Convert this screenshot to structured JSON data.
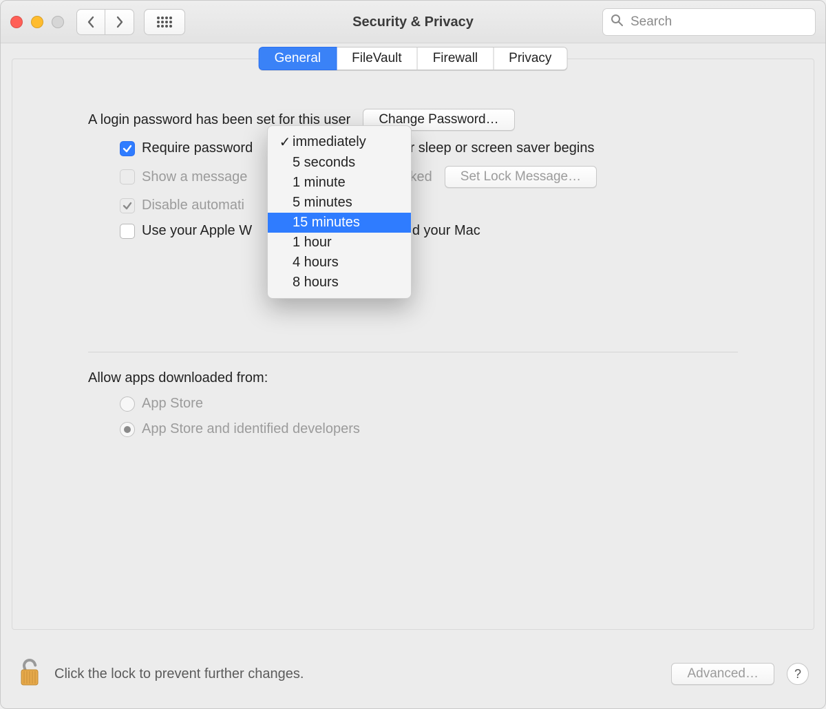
{
  "window": {
    "title": "Security & Privacy"
  },
  "search": {
    "placeholder": "Search"
  },
  "tabs": {
    "general": "General",
    "filevault": "FileVault",
    "firewall": "Firewall",
    "privacy": "Privacy"
  },
  "content": {
    "login_password_set": "A login password has been set for this user",
    "change_password_btn": "Change Password…",
    "require_password_label_pre": "Require password",
    "require_password_label_post": "after sleep or screen saver begins",
    "show_message_label": "Show a message",
    "show_message_label_suffix": "s locked",
    "set_lock_message_btn": "Set Lock Message…",
    "disable_automatic_label": "Disable automati",
    "use_apple_watch_label_pre": "Use your Apple W",
    "use_apple_watch_label_post": "s and your Mac",
    "allow_apps_heading": "Allow apps downloaded from:",
    "radio_app_store": "App Store",
    "radio_identified": "App Store and identified developers"
  },
  "dropdown": {
    "options": [
      "immediately",
      "5 seconds",
      "1 minute",
      "5 minutes",
      "15 minutes",
      "1 hour",
      "4 hours",
      "8 hours"
    ],
    "current": "immediately",
    "highlighted": "15 minutes"
  },
  "footer": {
    "lock_text": "Click the lock to prevent further changes.",
    "advanced_btn": "Advanced…",
    "help": "?"
  }
}
